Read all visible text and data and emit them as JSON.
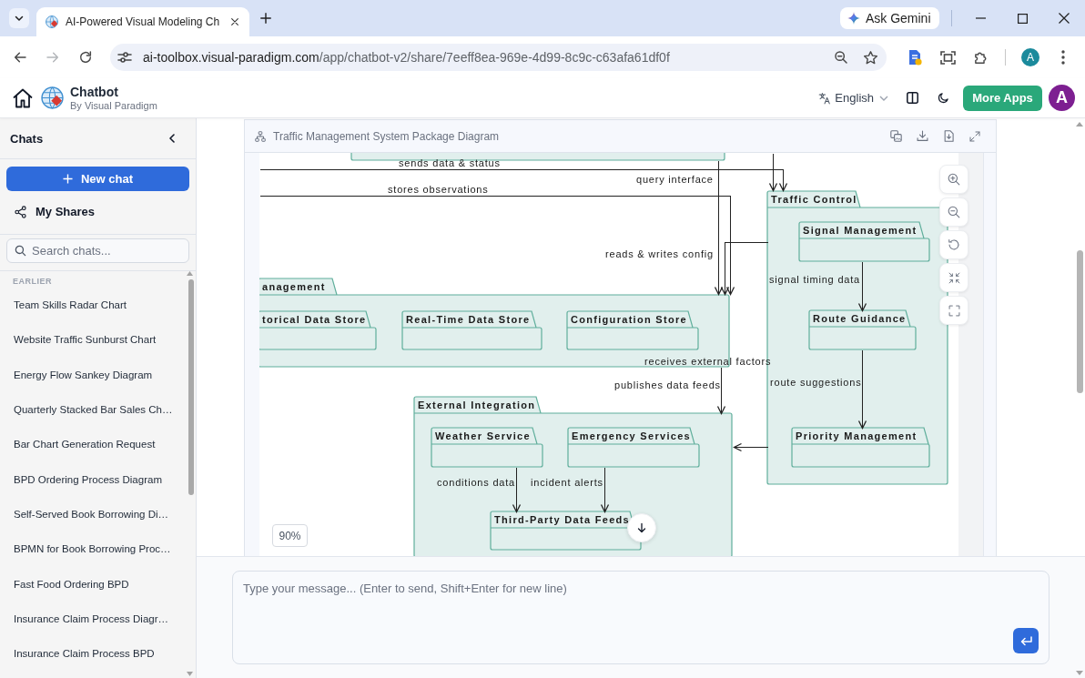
{
  "browser": {
    "tabs": [
      {
        "title": "AI-Powered Visual Modeling Ch",
        "selected": true
      }
    ],
    "gemini_button": "Ask Gemini",
    "navigation": [
      {
        "kind": "back",
        "disabled": false
      },
      {
        "kind": "forward",
        "disabled": true
      },
      {
        "kind": "reload",
        "disabled": false
      }
    ],
    "address_bar": {
      "host": "ai-toolbox.visual-paradigm.com",
      "path": "/app/chatbot-v2/share/7eeff8ea-969e-4d99-8c9c-c63afa61df0f"
    },
    "profile_initial": "A"
  },
  "app_header": {
    "title": "Chatbot",
    "subtitle": "By Visual Paradigm",
    "language": "English",
    "more_apps_button": "More Apps",
    "avatar_initial": "A"
  },
  "sidebar": {
    "title": "Chats",
    "new_chat_button": "New chat",
    "my_shares": "My Shares",
    "search": {
      "placeholder": "Search chats..."
    },
    "section_label": "EARLIER",
    "items": [
      {
        "label": "Team Skills Radar Chart",
        "selected": false
      },
      {
        "label": "Website Traffic Sunburst Chart",
        "selected": false
      },
      {
        "label": "Energy Flow Sankey Diagram",
        "selected": false
      },
      {
        "label": "Quarterly Stacked Bar Sales Ch…",
        "selected": false
      },
      {
        "label": "Bar Chart Generation Request",
        "selected": false
      },
      {
        "label": "BPD Ordering Process Diagram",
        "selected": false
      },
      {
        "label": "Self-Served Book Borrowing Di…",
        "selected": false
      },
      {
        "label": "BPMN for Book Borrowing Proc…",
        "selected": false
      },
      {
        "label": "Fast Food Ordering BPD",
        "selected": false
      },
      {
        "label": "Insurance Claim Process Diagr…",
        "selected": false
      },
      {
        "label": "Insurance Claim Process BPD",
        "selected": false
      }
    ]
  },
  "diagram_panel": {
    "title": "Traffic Management System Package Diagram",
    "diagram": {
      "packages": [
        {
          "name": "Traffic Control",
          "children": [
            {
              "name": "Signal Management"
            },
            {
              "name": "Route Guidance"
            },
            {
              "name": "Priority Management"
            }
          ]
        },
        {
          "name": "anagement",
          "children": [
            {
              "name": "torical Data Store"
            },
            {
              "name": "Real-Time Data Store"
            },
            {
              "name": "Configuration Store"
            }
          ]
        },
        {
          "name": "External Integration",
          "children": [
            {
              "name": "Weather Service"
            },
            {
              "name": "Emergency Services"
            },
            {
              "name": "Third-Party Data Feeds"
            }
          ]
        }
      ],
      "connectors": [
        {
          "label": "sends data & status"
        },
        {
          "label": "query interface"
        },
        {
          "label": "stores observations"
        },
        {
          "label": "reads & writes config"
        },
        {
          "label": "signal timing data"
        },
        {
          "label": "receives external factors"
        },
        {
          "label": "publishes data feeds"
        },
        {
          "label": "route suggestions"
        },
        {
          "label": "conditions data"
        },
        {
          "label": "incident alerts"
        }
      ]
    },
    "zoom_level": "90%"
  },
  "composer": {
    "placeholder": "Type your message... (Enter to send, Shift+Enter for new line)"
  }
}
